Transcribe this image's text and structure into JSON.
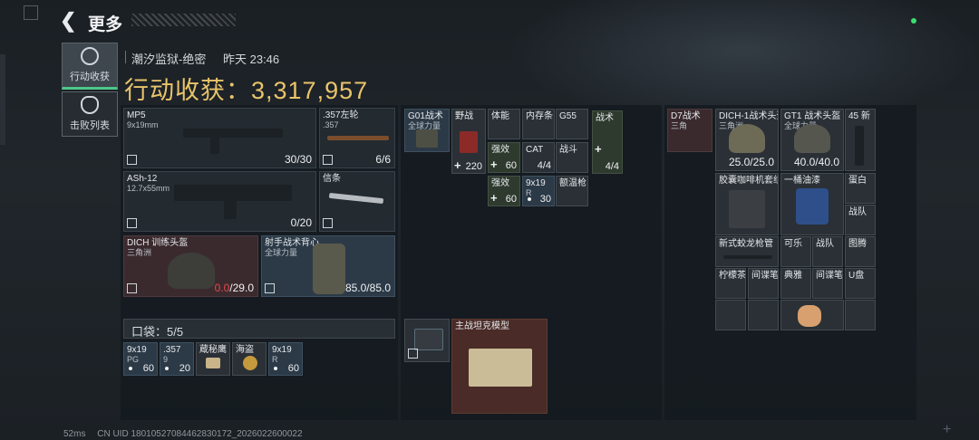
{
  "header": {
    "title": "更多",
    "back_icon": "chevron-left-icon"
  },
  "sidebar": {
    "tabs": [
      {
        "label": "行动收获",
        "icon": "target-icon",
        "active": true
      },
      {
        "label": "击败列表",
        "icon": "skull-icon",
        "active": false
      }
    ]
  },
  "raid": {
    "map": "潮汐监狱-绝密",
    "time": "昨天 23:46",
    "value_label": "行动收获：3,317,957"
  },
  "loadout": {
    "primary1": {
      "name": "MP5",
      "caliber": "9x19mm",
      "ammo": "30/30"
    },
    "sidearm": {
      "name": ".357左轮",
      "caliber": ".357",
      "ammo": "6/6"
    },
    "primary2": {
      "name": "ASh-12",
      "caliber": "12.7x55mm",
      "ammo": "0/20"
    },
    "melee": {
      "name": "信条"
    },
    "helmet": {
      "name": "DICH 训练头盔",
      "faction": "三角洲",
      "dur_current": "0.0",
      "dur_max": "/29.0"
    },
    "armor": {
      "name": "射手战术背心",
      "faction": "全球力量",
      "durability": "85.0/85.0"
    },
    "pocket_label": "口袋：5/5",
    "pocket": [
      {
        "name": "9x19",
        "sub": "PG",
        "qty": "60"
      },
      {
        "name": ".357",
        "sub": "9",
        "qty": "20"
      },
      {
        "name": "蔵秘鹰",
        "sub": "",
        "qty": ""
      },
      {
        "name": "海盗",
        "sub": "",
        "qty": ""
      },
      {
        "name": "9x19",
        "sub": "R",
        "qty": "60"
      }
    ]
  },
  "rig": {
    "items": [
      {
        "name": "G01战术",
        "sub": "全球力量"
      },
      {
        "name": "野战",
        "qty": "220"
      },
      {
        "name": "体能"
      },
      {
        "name": "内存条"
      },
      {
        "name": "G55"
      },
      {
        "name": "战术"
      },
      {
        "name": "强效",
        "qty": "60"
      },
      {
        "name": "CAT",
        "qty": "4/4"
      },
      {
        "name": "战斗"
      },
      {
        "name": "",
        "qty": "4/4"
      },
      {
        "name": "强效",
        "qty": "60"
      },
      {
        "name": "9x19",
        "sub": "R",
        "qty": "30"
      },
      {
        "name": "额温枪"
      }
    ]
  },
  "safebox": {
    "item_name": "主战坦克模型"
  },
  "backpack": {
    "items": [
      {
        "name": "D7战术",
        "sub": "三角"
      },
      {
        "name": "DICH-1战术头盔",
        "sub": "三角洲",
        "durability": "25.0/25.0"
      },
      {
        "name": "GT1 战术头盔",
        "sub": "全球力量",
        "durability": "40.0/40.0"
      },
      {
        "name": "45 新"
      },
      {
        "name": "胶囊咖啡机套组"
      },
      {
        "name": "一桶油漆"
      },
      {
        "name": "蛋白"
      },
      {
        "name": "战队"
      },
      {
        "name": "新式蛟龙枪管"
      },
      {
        "name": "可乐"
      },
      {
        "name": "战队"
      },
      {
        "name": "图腾"
      },
      {
        "name": "柠檬茶"
      },
      {
        "name": "间谍笔"
      },
      {
        "name": "典雅"
      },
      {
        "name": "间谍笔"
      },
      {
        "name": "U盘"
      }
    ]
  },
  "footer": {
    "ping": "52ms",
    "uid": "CN UID 18010527084462830172_2026022600022"
  }
}
